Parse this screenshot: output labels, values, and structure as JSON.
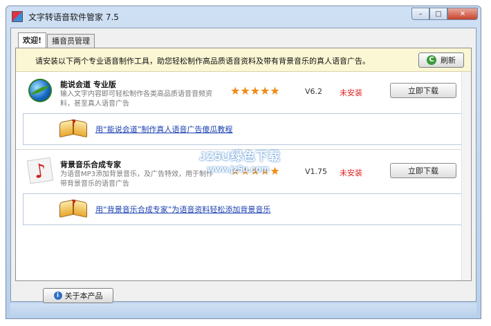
{
  "window": {
    "title": "文字转语音软件管家 7.5",
    "controls": {
      "minimize": "–",
      "maximize": "□",
      "close": "✕"
    }
  },
  "tabs": [
    {
      "label": "欢迎!",
      "active": true
    },
    {
      "label": "播音员管理",
      "active": false
    }
  ],
  "notice": {
    "text": "请安装以下两个专业语音制作工具，助您轻松制作高品质语音资料及带有背景音乐的真人语音广告。",
    "refresh_label": "刷新"
  },
  "products": [
    {
      "name": "能说会道 专业版",
      "description": "输入文字内容即可轻松制作各类高品质语音音频资料，甚至真人语音广告",
      "stars": "★★★★★",
      "rating": 5,
      "version": "V6.2",
      "status": "未安装",
      "download_label": "立即下载",
      "tutorial_link": "用“能说会道”制作真人语音广告傻瓜教程",
      "icon": "globe-icon"
    },
    {
      "name": "背景音乐合成专家",
      "description": "为语音MP3添加背景音乐，及广告特效，用于制作带背景音乐的语音广告",
      "stars": "★★★★★",
      "rating": 5,
      "version": "V1.75",
      "status": "未安装",
      "download_label": "立即下载",
      "tutorial_link": "用“背景音乐合成专家”为语音资料轻松添加背景音乐",
      "icon": "music-note-icon"
    }
  ],
  "footer": {
    "about_label": "关于本产品"
  },
  "watermark": {
    "line1": "JZ5U绿色下载",
    "line2": "www.jz5u.com"
  },
  "colors": {
    "title_bar": "#cfe0f4",
    "notice_bg": "#fbf7d4",
    "status_red": "#e02020",
    "star_orange": "#f08a14",
    "link_blue": "#1a3fb0"
  }
}
